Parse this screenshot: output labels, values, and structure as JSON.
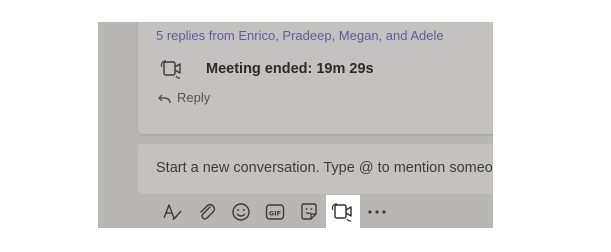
{
  "thread": {
    "replies_link": "5 replies from Enrico, Pradeep, Megan, and Adele",
    "meeting_status": "Meeting ended: 19m 29s",
    "reply_label": "Reply"
  },
  "compose": {
    "placeholder": "Start a new conversation. Type @ to mention someo"
  },
  "toolbar": {
    "items": [
      {
        "icon": "format-icon"
      },
      {
        "icon": "attach-icon"
      },
      {
        "icon": "emoji-icon"
      },
      {
        "icon": "gif-icon",
        "label": "GIF"
      },
      {
        "icon": "sticker-icon"
      },
      {
        "icon": "meet-now-icon",
        "highlighted": true
      },
      {
        "icon": "more-options-icon"
      }
    ]
  },
  "colors": {
    "overlay": "#b9b7b6",
    "card": "#c4c2c1",
    "link": "#5e5d95",
    "highlight": "#ffffff"
  }
}
